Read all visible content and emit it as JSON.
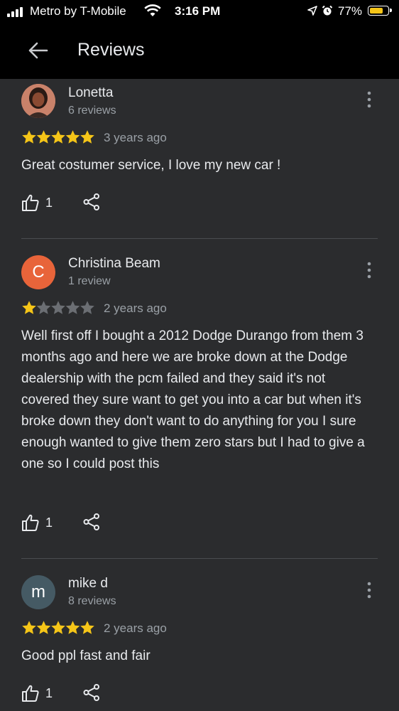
{
  "status_bar": {
    "carrier": "Metro by T-Mobile",
    "time": "3:16 PM",
    "battery_percent": "77%",
    "battery_level": 0.77
  },
  "header": {
    "title": "Reviews",
    "back_icon": "arrow-left-icon"
  },
  "reviews": [
    {
      "name": "Lonetta",
      "review_count": "6 reviews",
      "rating": 5,
      "time_ago": "3 years ago",
      "text": "Great costumer service, I love my new car !",
      "likes": "1",
      "avatar_type": "photo"
    },
    {
      "name": "Christina Beam",
      "review_count": "1 review",
      "rating": 1,
      "time_ago": "2 years ago",
      "text": "Well first off I bought a 2012 Dodge Durango from them 3 months ago and here we are broke down at the Dodge dealership with the pcm failed and they said it's not covered they sure want to get you into a car but when it's broke down they don't want to do anything for you I sure enough wanted to give them zero stars but I had to give a one so I could post this",
      "likes": "1",
      "avatar_letter": "C",
      "avatar_color": "#e8643a"
    },
    {
      "name": "mike d",
      "review_count": "8 reviews",
      "rating": 5,
      "time_ago": "2 years ago",
      "text": "Good ppl fast and fair",
      "likes": "1",
      "avatar_letter": "m",
      "avatar_color": "#455a64"
    }
  ],
  "colors": {
    "background": "#2b2c2e",
    "star_filled": "#f5c518",
    "star_empty": "#6b6e73"
  }
}
